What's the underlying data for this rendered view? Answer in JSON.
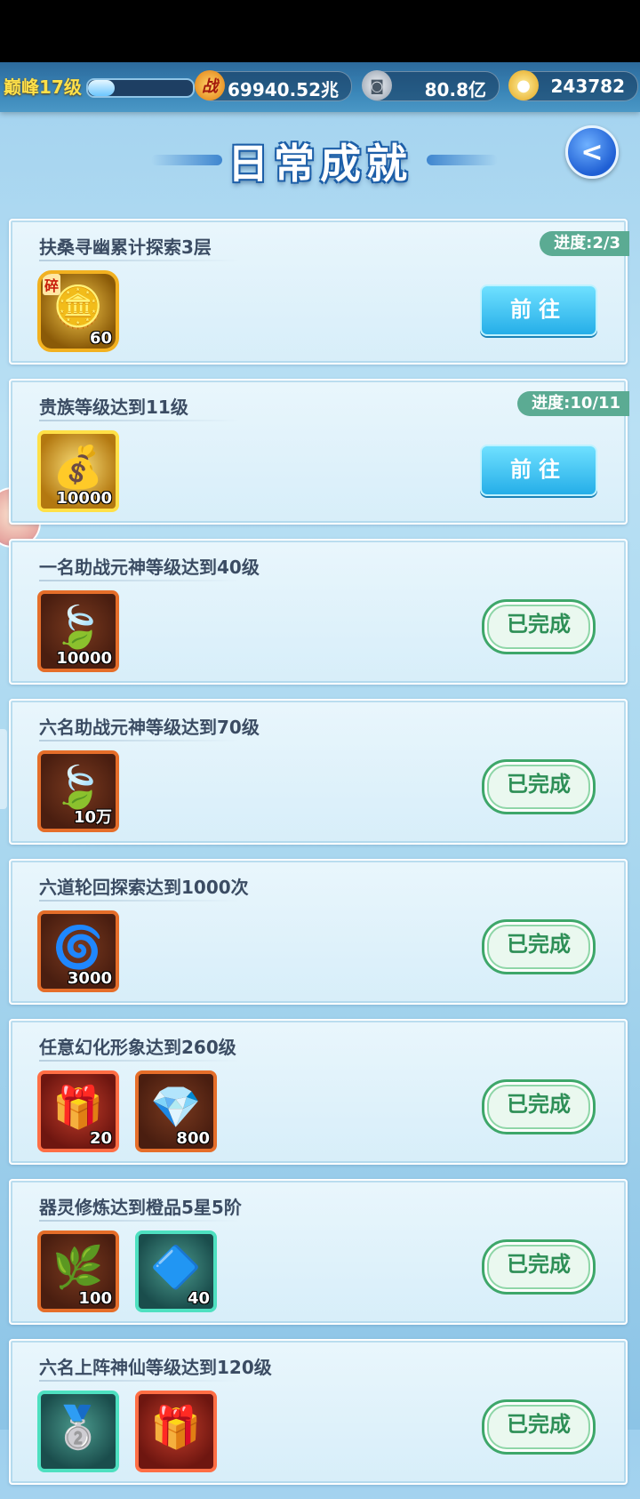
{
  "topbar": {
    "level": "巅峰17级",
    "level_progress": 0.25,
    "power_icon": "战",
    "power": "69940.52兆",
    "coin_icon": "coin-icon",
    "coins": "80.8亿",
    "ingot_icon": "gold-ingot-icon",
    "ingots": "243782"
  },
  "page": {
    "title": "日常成就",
    "back_icon": "back-arrow-icon"
  },
  "achievements": [
    {
      "title": "扶桑寻幽累计探索3层",
      "progress": "进度:2/3",
      "status": "go",
      "button": "前往",
      "rewards": [
        {
          "icon": "golden-token-fragment-icon",
          "qty": "60",
          "frag": "碎",
          "frame": "octgold"
        }
      ]
    },
    {
      "title": "贵族等级达到11级",
      "progress": "进度:10/11",
      "status": "go",
      "button": "前往",
      "rewards": [
        {
          "icon": "gold-ingot-pile-icon",
          "qty": "10000",
          "frame": "gold"
        }
      ]
    },
    {
      "title": "一名助战元神等级达到40级",
      "status": "done",
      "button": "已完成",
      "rewards": [
        {
          "icon": "green-spirit-leaf-icon",
          "qty": "10000",
          "frame": "orange"
        }
      ]
    },
    {
      "title": "六名助战元神等级达到70级",
      "status": "done",
      "button": "已完成",
      "rewards": [
        {
          "icon": "green-spirit-leaf-icon",
          "qty": "10万",
          "frame": "orange"
        }
      ]
    },
    {
      "title": "六道轮回探索达到1000次",
      "status": "done",
      "button": "已完成",
      "rewards": [
        {
          "icon": "green-cloud-jade-icon",
          "qty": "3000",
          "frame": "orange"
        }
      ]
    },
    {
      "title": "任意幻化形象达到260级",
      "status": "done",
      "button": "已完成",
      "rewards": [
        {
          "icon": "red-lucky-bag-icon",
          "qty": "20",
          "frame": "red"
        },
        {
          "icon": "cyan-crystal-icon",
          "qty": "800",
          "frame": "orange"
        }
      ]
    },
    {
      "title": "器灵修炼达到橙品5星5阶",
      "status": "done",
      "button": "已完成",
      "rewards": [
        {
          "icon": "herb-pot-icon",
          "qty": "100",
          "frame": "orange"
        },
        {
          "icon": "blue-powder-pile-icon",
          "qty": "40",
          "frame": "teal"
        }
      ]
    },
    {
      "title": "六名上阵神仙等级达到120级",
      "status": "done",
      "button": "已完成",
      "rewards": [
        {
          "icon": "silver-token-icon",
          "qty": "",
          "frame": "teal"
        },
        {
          "icon": "red-lucky-bag-icon",
          "qty": "",
          "frame": "red"
        }
      ]
    }
  ]
}
